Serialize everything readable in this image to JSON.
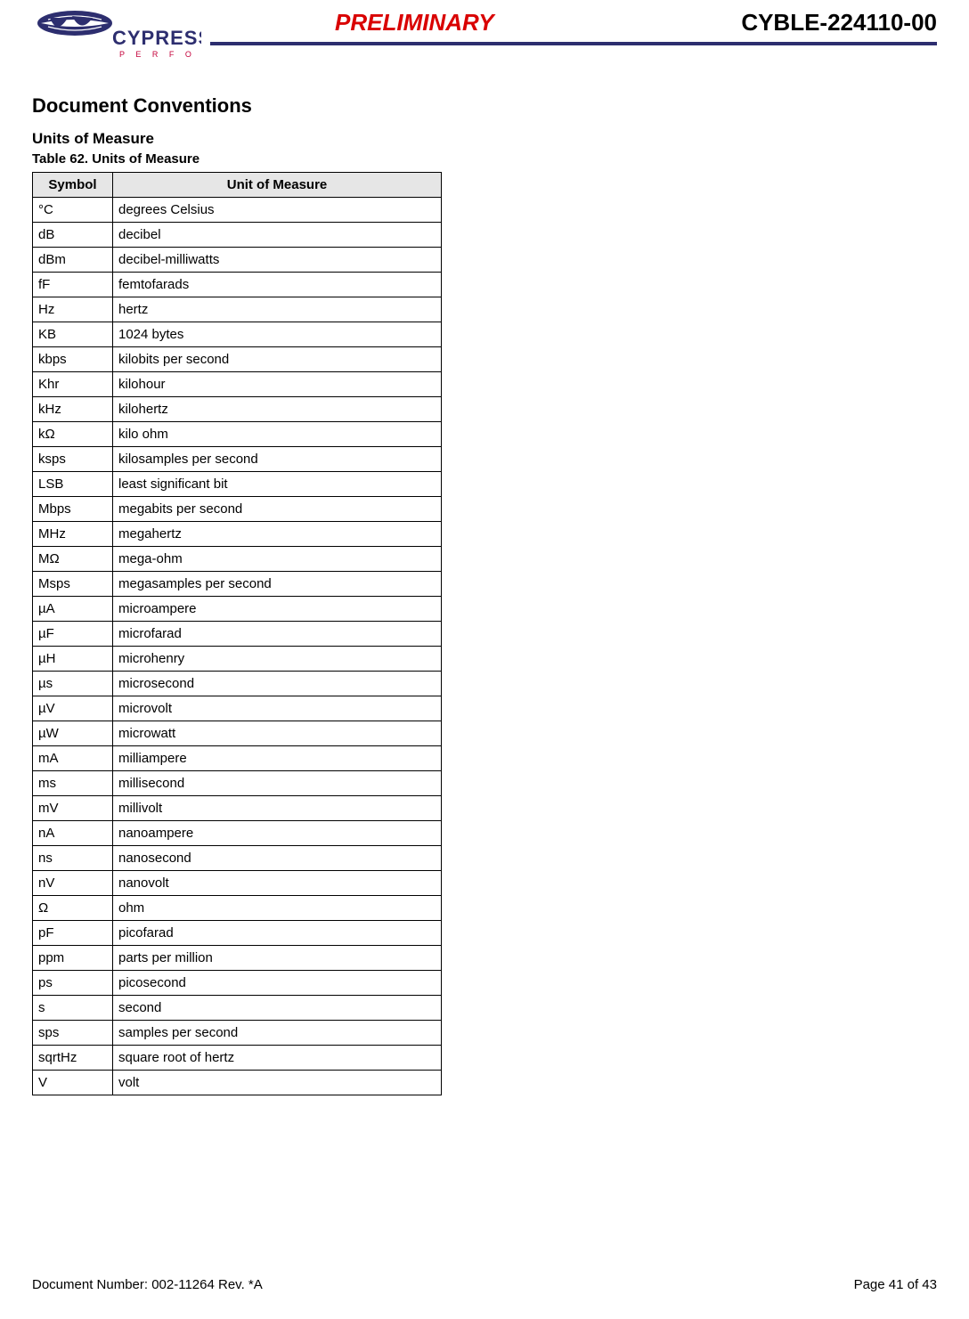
{
  "header": {
    "logo_company": "CYPRESS",
    "logo_tagline": "P E R F O R M",
    "preliminary": "PRELIMINARY",
    "part_number": "CYBLE-224110-00"
  },
  "section": {
    "title": "Document Conventions",
    "subsection": "Units of Measure",
    "table_caption": "Table 62.  Units of Measure"
  },
  "table": {
    "headers": {
      "symbol": "Symbol",
      "unit": "Unit of Measure"
    },
    "rows": [
      {
        "symbol": "°C",
        "unit": "degrees Celsius"
      },
      {
        "symbol": "dB",
        "unit": "decibel"
      },
      {
        "symbol": "dBm",
        "unit": "decibel-milliwatts"
      },
      {
        "symbol": "fF",
        "unit": "femtofarads"
      },
      {
        "symbol": "Hz",
        "unit": "hertz"
      },
      {
        "symbol": "KB",
        "unit": "1024 bytes"
      },
      {
        "symbol": "kbps",
        "unit": "kilobits per second"
      },
      {
        "symbol": "Khr",
        "unit": "kilohour"
      },
      {
        "symbol": "kHz",
        "unit": "kilohertz"
      },
      {
        "symbol": "kΩ",
        "unit": "kilo ohm"
      },
      {
        "symbol": "ksps",
        "unit": "kilosamples per second"
      },
      {
        "symbol": "LSB",
        "unit": "least significant bit"
      },
      {
        "symbol": "Mbps",
        "unit": "megabits per second"
      },
      {
        "symbol": "MHz",
        "unit": "megahertz"
      },
      {
        "symbol": "MΩ",
        "unit": "mega-ohm"
      },
      {
        "symbol": "Msps",
        "unit": "megasamples per second"
      },
      {
        "symbol": "µA",
        "unit": "microampere"
      },
      {
        "symbol": "µF",
        "unit": "microfarad"
      },
      {
        "symbol": "µH",
        "unit": "microhenry"
      },
      {
        "symbol": "µs",
        "unit": "microsecond"
      },
      {
        "symbol": "µV",
        "unit": "microvolt"
      },
      {
        "symbol": "µW",
        "unit": "microwatt"
      },
      {
        "symbol": "mA",
        "unit": "milliampere"
      },
      {
        "symbol": "ms",
        "unit": "millisecond"
      },
      {
        "symbol": "mV",
        "unit": "millivolt"
      },
      {
        "symbol": "nA",
        "unit": "nanoampere"
      },
      {
        "symbol": "ns",
        "unit": "nanosecond"
      },
      {
        "symbol": "nV",
        "unit": "nanovolt"
      },
      {
        "symbol": "Ω",
        "unit": "ohm"
      },
      {
        "symbol": "pF",
        "unit": "picofarad"
      },
      {
        "symbol": "ppm",
        "unit": "parts per million"
      },
      {
        "symbol": "ps",
        "unit": "picosecond"
      },
      {
        "symbol": "s",
        "unit": "second"
      },
      {
        "symbol": "sps",
        "unit": "samples per second"
      },
      {
        "symbol": "sqrtHz",
        "unit": "square root of hertz"
      },
      {
        "symbol": "V",
        "unit": "volt"
      }
    ]
  },
  "footer": {
    "doc_number": "Document Number: 002-11264 Rev. *A",
    "page": "Page 41 of 43"
  }
}
